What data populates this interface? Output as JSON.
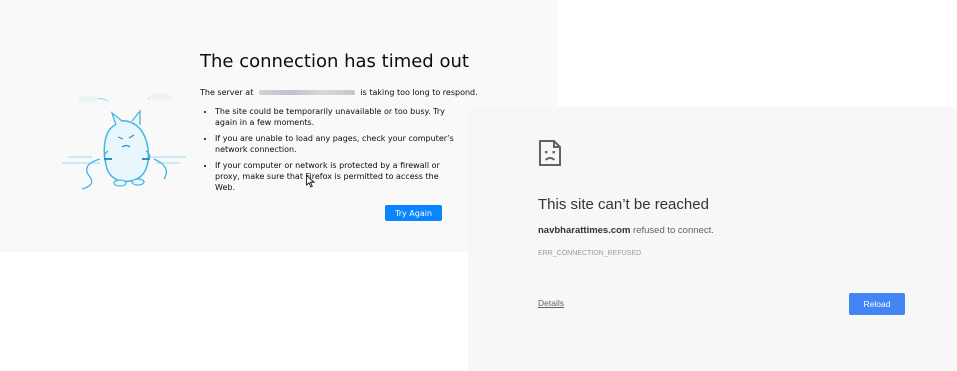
{
  "firefox": {
    "title": "The connection has timed out",
    "desc_before": "The server at",
    "desc_after": "is taking too long to respond.",
    "bullets": [
      "The site could be temporarily unavailable or too busy. Try again in a few moments.",
      "If you are unable to load any pages, check your computer’s network connection.",
      "If your computer or network is protected by a firewall or proxy, make sure that Firefox is permitted to access the Web."
    ],
    "try_again_label": "Try Again",
    "accent_color": "#0a84ff"
  },
  "chrome": {
    "title": "This site can’t be reached",
    "host": "navbharattimes.com",
    "desc_suffix": " refused to connect.",
    "error_code": "ERR_CONNECTION_REFUSED",
    "details_label": "Details",
    "reload_label": "Reload",
    "accent_color": "#4285f4",
    "icon": "sad-page-icon"
  }
}
